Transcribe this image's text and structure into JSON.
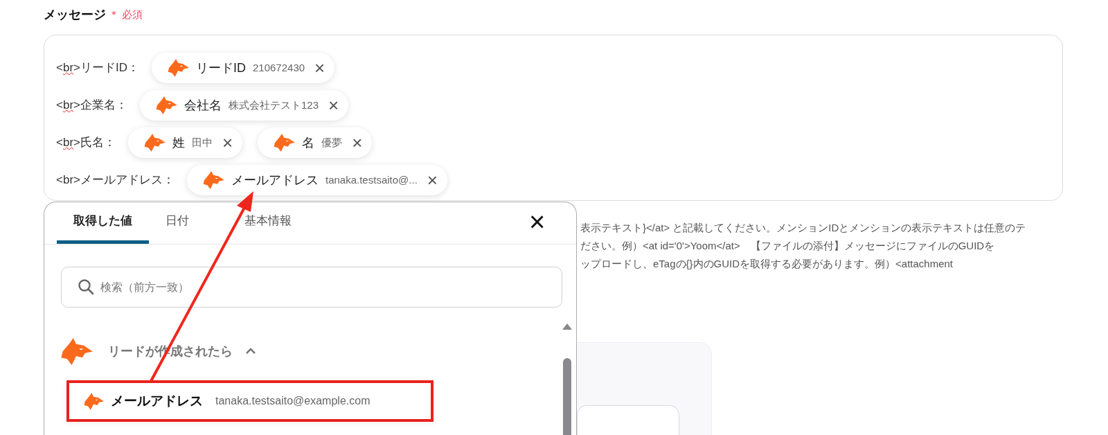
{
  "field": {
    "label": "メッセージ",
    "required_mark": "＊",
    "required_text": "必須"
  },
  "lines": [
    {
      "open": "<",
      "tag": "br",
      "rest": ">リードID：",
      "misspelled": true,
      "chips": [
        {
          "name": "リードID",
          "value": "210672430",
          "remove": "×"
        }
      ]
    },
    {
      "open": "<",
      "tag": "br",
      "rest": ">企業名：",
      "misspelled": true,
      "chips": [
        {
          "name": "会社名",
          "value": "株式会社テスト123",
          "remove": "×"
        }
      ]
    },
    {
      "open": "<",
      "tag": "br",
      "rest": ">氏名：",
      "misspelled": true,
      "chips": [
        {
          "name": "姓",
          "value": "田中",
          "remove": "×"
        },
        {
          "name": "名",
          "value": "優夢",
          "remove": "×"
        }
      ]
    },
    {
      "open": "<",
      "tag": "br",
      "rest": ">メールアドレス：",
      "misspelled": false,
      "chips": [
        {
          "name": "メールアドレス",
          "value": "tanaka.testsaito@...",
          "remove": "×"
        }
      ]
    }
  ],
  "help_text": [
    "表示テキスト}</at> と記載してください。メンションIDとメンションの表示テキストは任意のテ",
    "ださい。例）<at id='0'>Yoom</at>　【ファイルの添付】メッセージにファイルのGUIDを",
    "ップロードし、eTagの{}内のGUIDを取得する必要があります。例）<attachment"
  ],
  "panel": {
    "tabs": [
      {
        "label": "取得した値",
        "selected": true
      },
      {
        "label": "日付",
        "selected": false
      },
      {
        "label": "基本情報",
        "selected": false
      }
    ],
    "close": "×",
    "search": {
      "placeholder": "検索（前方一致）"
    },
    "groups": [
      {
        "title": "リードが作成されたら",
        "expanded": true,
        "items": [
          {
            "label": "メールアドレス",
            "value": "tanaka.testsaito@example.com",
            "highlighted": true
          }
        ]
      }
    ]
  }
}
